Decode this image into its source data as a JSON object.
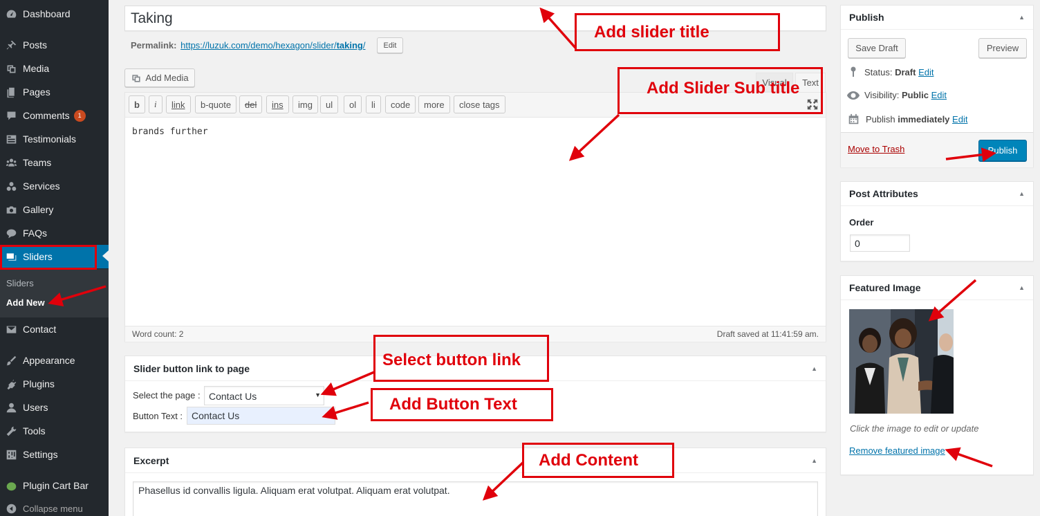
{
  "menu": {
    "dashboard": "Dashboard",
    "posts": "Posts",
    "media": "Media",
    "pages": "Pages",
    "comments": "Comments",
    "comments_badge": "1",
    "testimonials": "Testimonials",
    "teams": "Teams",
    "services": "Services",
    "gallery": "Gallery",
    "faqs": "FAQs",
    "sliders": "Sliders",
    "sub_sliders": "Sliders",
    "sub_add_new": "Add New",
    "contact": "Contact",
    "appearance": "Appearance",
    "plugins": "Plugins",
    "users": "Users",
    "tools": "Tools",
    "settings": "Settings",
    "plugin_cart_bar": "Plugin Cart Bar",
    "collapse": "Collapse menu"
  },
  "editor": {
    "title_value": "Taking",
    "permalink_label": "Permalink:",
    "permalink_base": "https://luzuk.com/demo/hexagon/slider/",
    "permalink_slug": "taking",
    "permalink_slash": "/",
    "edit_button": "Edit",
    "add_media": "Add Media",
    "tab_visual": "Visual",
    "tab_text": "Text",
    "quicktags": [
      "b",
      "i",
      "link",
      "b-quote",
      "del",
      "ins",
      "img",
      "ul",
      "ol",
      "li",
      "code",
      "more",
      "close tags"
    ],
    "content": "brands further",
    "word_count": "Word count: 2",
    "draft_saved": "Draft saved at 11:41:59 am."
  },
  "slider_button": {
    "heading": "Slider button link to page",
    "select_label": "Select the page :",
    "select_value": "Contact Us",
    "button_text_label": "Button Text :",
    "button_text_value": "Contact Us"
  },
  "excerpt": {
    "heading": "Excerpt",
    "value": "Phasellus id convallis ligula. Aliquam erat volutpat. Aliquam erat volutpat."
  },
  "publish": {
    "heading": "Publish",
    "save_draft": "Save Draft",
    "preview": "Preview",
    "status_label": "Status:",
    "status_value": "Draft",
    "visibility_label": "Visibility:",
    "visibility_value": "Public",
    "publish_label": "Publish",
    "publish_value": "immediately",
    "edit": "Edit",
    "move_to_trash": "Move to Trash",
    "publish_button": "Publish"
  },
  "attributes": {
    "heading": "Post Attributes",
    "order_label": "Order",
    "order_value": "0"
  },
  "featured": {
    "heading": "Featured Image",
    "hint": "Click the image to edit or update",
    "remove": "Remove featured image"
  },
  "annotations": {
    "slider_title": "Add slider title",
    "sub_title": "Add Slider Sub title",
    "button_link": "Select button link",
    "button_text": "Add Button Text",
    "content": "Add Content"
  },
  "colors": {
    "accent": "#0073aa",
    "annotation": "#e0000b",
    "sidebar": "#23282d"
  }
}
